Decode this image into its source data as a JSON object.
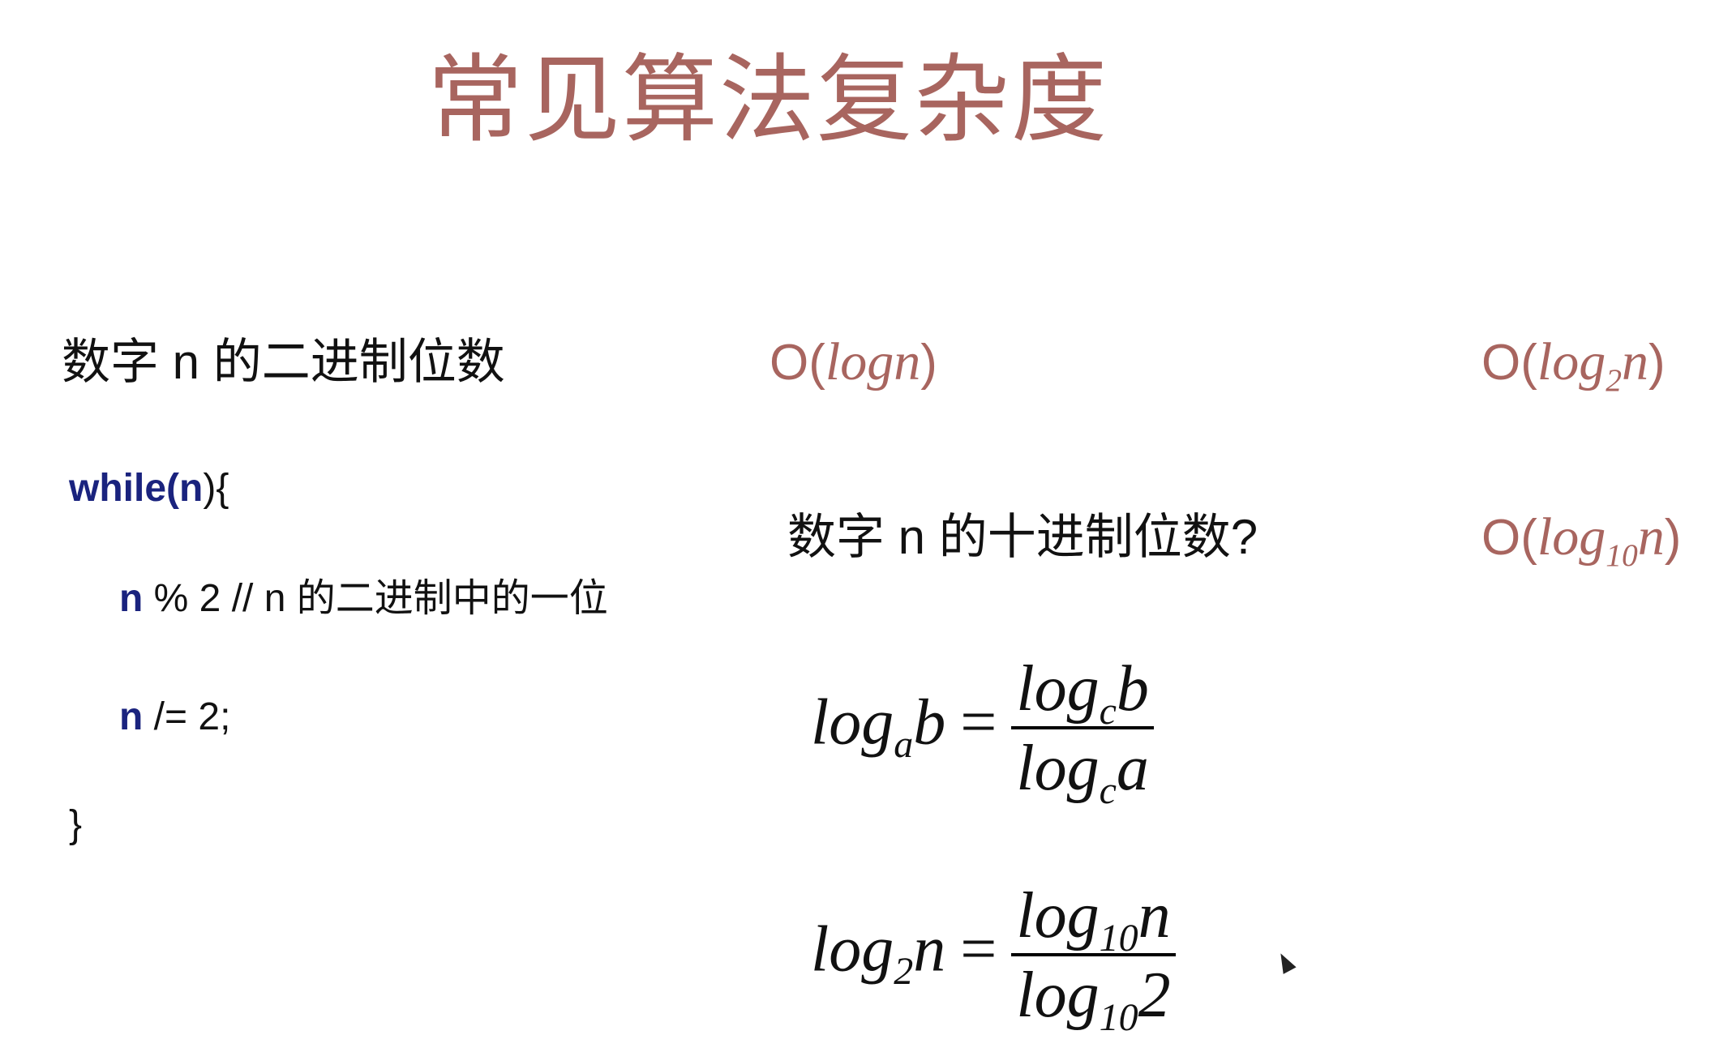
{
  "title": "常见算法复杂度",
  "row1": {
    "label": "数字 n 的二进制位数",
    "complexity_prefix": "O(",
    "complexity_fn": "logn",
    "complexity_suffix": ")",
    "complexity2_prefix": "O(",
    "complexity2_log": "log",
    "complexity2_base": "2",
    "complexity2_arg": "n",
    "complexity2_suffix": ")"
  },
  "row2": {
    "label": "数字 n 的十进制位数?",
    "complexity_prefix": "O(",
    "complexity_log": "log",
    "complexity_base": "10",
    "complexity_arg": "n",
    "complexity_suffix": ")"
  },
  "code": {
    "line1_kw": "while(",
    "line1_var": "n",
    "line1_rest": "){",
    "line2_var": "n",
    "line2_rest": " % 2 // n 的二进制中的一位",
    "line3_var": "n",
    "line3_rest": " /= 2;",
    "line4": "}"
  },
  "formula1": {
    "lhs_log": "log",
    "lhs_base": "a",
    "lhs_arg": "b",
    "eq": "=",
    "num_log": "log",
    "num_base": "c",
    "num_arg": "b",
    "den_log": "log",
    "den_base": "c",
    "den_arg": "a"
  },
  "formula2": {
    "lhs_log": "log",
    "lhs_base": "2",
    "lhs_arg": "n",
    "eq": "=",
    "num_log": "log",
    "num_base": "10",
    "num_arg": "n",
    "den_log": "log",
    "den_base": "10",
    "den_arg": "2"
  },
  "colors": {
    "accent": "#a8655f",
    "keyword": "#1a237e",
    "text": "#111111"
  },
  "icons": {
    "cursor": "mouse-pointer-icon"
  }
}
